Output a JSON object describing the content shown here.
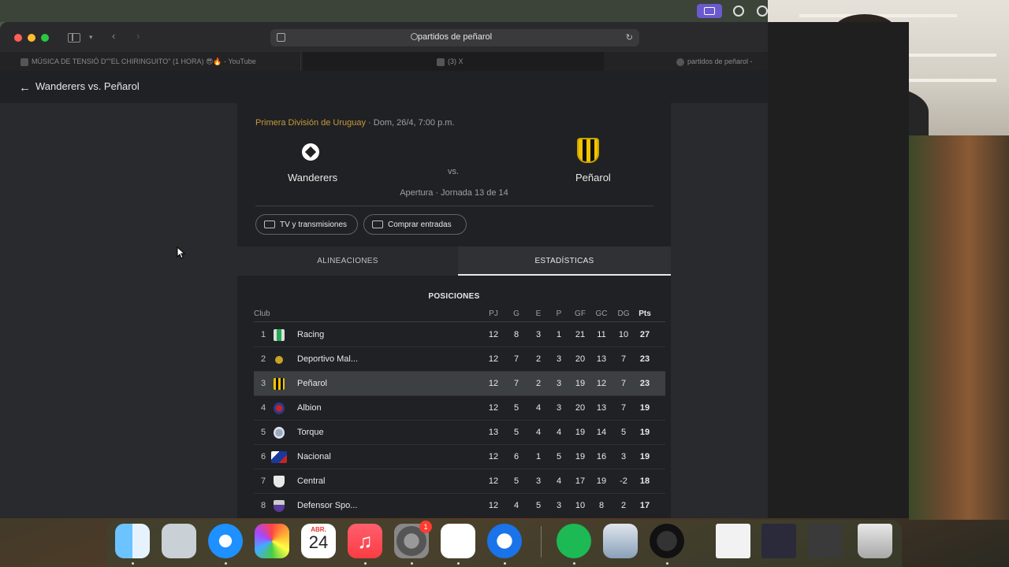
{
  "browser": {
    "address": "partidos de peñarol",
    "tabs": [
      {
        "label": "MÚSICA DE TENSIÓ D\"\"EL CHIRINGUITO\" (1 HORA) 😎🔥 - YouTube"
      },
      {
        "label": "(3) X"
      },
      {
        "label": "partidos de peñarol -"
      }
    ]
  },
  "page": {
    "title": "Wanderers vs. Peñarol",
    "match": {
      "league": "Primera División de Uruguay",
      "datetime": " · Dom, 26/4, 7:00 p.m.",
      "home": "Wanderers",
      "away": "Peñarol",
      "vs": "vs.",
      "round": "Apertura · Jornada 13 de 14"
    },
    "chips": {
      "tv": "TV y transmisiones",
      "tickets": "Comprar entradas"
    },
    "tabs": {
      "lineups": "ALINEACIONES",
      "stats": "ESTADÍSTICAS"
    },
    "standings": {
      "title": "POSICIONES",
      "headers": {
        "club": "Club",
        "pj": "PJ",
        "g": "G",
        "e": "E",
        "p": "P",
        "gf": "GF",
        "gc": "GC",
        "dg": "DG",
        "pts": "Pts"
      },
      "rows": [
        {
          "rank": "1",
          "team": "Racing",
          "pj": "12",
          "g": "8",
          "e": "3",
          "p": "1",
          "gf": "21",
          "gc": "11",
          "dg": "10",
          "pts": "27"
        },
        {
          "rank": "2",
          "team": "Deportivo Mal...",
          "pj": "12",
          "g": "7",
          "e": "2",
          "p": "3",
          "gf": "20",
          "gc": "13",
          "dg": "7",
          "pts": "23"
        },
        {
          "rank": "3",
          "team": "Peñarol",
          "pj": "12",
          "g": "7",
          "e": "2",
          "p": "3",
          "gf": "19",
          "gc": "12",
          "dg": "7",
          "pts": "23"
        },
        {
          "rank": "4",
          "team": "Albion",
          "pj": "12",
          "g": "5",
          "e": "4",
          "p": "3",
          "gf": "20",
          "gc": "13",
          "dg": "7",
          "pts": "19"
        },
        {
          "rank": "5",
          "team": "Torque",
          "pj": "13",
          "g": "5",
          "e": "4",
          "p": "4",
          "gf": "19",
          "gc": "14",
          "dg": "5",
          "pts": "19"
        },
        {
          "rank": "6",
          "team": "Nacional",
          "pj": "12",
          "g": "6",
          "e": "1",
          "p": "5",
          "gf": "19",
          "gc": "16",
          "dg": "3",
          "pts": "19"
        },
        {
          "rank": "7",
          "team": "Central",
          "pj": "12",
          "g": "5",
          "e": "3",
          "p": "4",
          "gf": "17",
          "gc": "19",
          "dg": "-2",
          "pts": "18"
        },
        {
          "rank": "8",
          "team": "Defensor Spo...",
          "pj": "12",
          "g": "4",
          "e": "5",
          "p": "3",
          "gf": "10",
          "gc": "8",
          "dg": "2",
          "pts": "17"
        }
      ]
    }
  },
  "dock": {
    "calendar_month": "ABR.",
    "calendar_day": "24",
    "settings_badge": "1"
  }
}
